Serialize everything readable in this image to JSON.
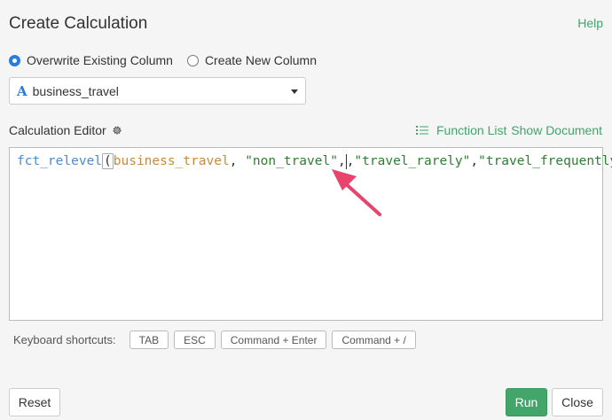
{
  "header": {
    "title": "Create Calculation",
    "help_label": "Help"
  },
  "mode": {
    "options": [
      {
        "label": "Overwrite Existing Column",
        "checked": true
      },
      {
        "label": "Create New Column",
        "checked": false
      }
    ]
  },
  "column_select": {
    "type_icon": "A",
    "value": "business_travel"
  },
  "editor": {
    "label": "Calculation Editor",
    "function_list_label": "Function List",
    "show_document_label": "Show Document",
    "code": {
      "fn": "fct_relevel",
      "open_paren": "(",
      "var": "business_travel",
      "sep1": ", ",
      "str1": "\"non_travel\"",
      "sep2": ",",
      "sep3": ",",
      "str2": "\"travel_rarely\"",
      "sep4": ",",
      "str3": "\"travel_frequently\""
    },
    "annotation_color": "#e8456e"
  },
  "shortcuts": {
    "label": "Keyboard shortcuts:",
    "keys": [
      "TAB",
      "ESC",
      "Command + Enter",
      "Command + /"
    ]
  },
  "footer": {
    "reset_label": "Reset",
    "run_label": "Run",
    "close_label": "Close"
  },
  "colors": {
    "accent_green": "#3ea66a",
    "run_button": "#44a56a",
    "radio_blue": "#2a7ae2"
  }
}
